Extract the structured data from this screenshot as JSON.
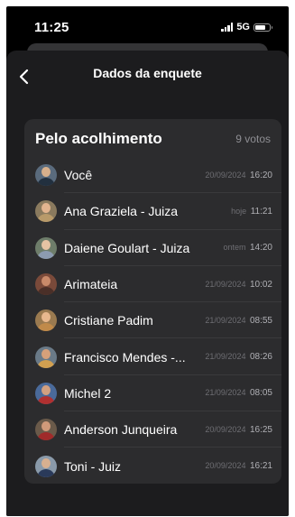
{
  "status_bar": {
    "time": "11:25",
    "network": "5G"
  },
  "header": {
    "title": "Dados da enquete",
    "back_icon": "chevron-left-icon"
  },
  "poll": {
    "option_title": "Pelo acolhimento",
    "vote_count": "9 votos",
    "votes": [
      {
        "name": "Você",
        "date": "20/09/2024",
        "time": "16:20",
        "avatar_bg": "#5a6b7d",
        "avatar_skin": "#d8b08c",
        "avatar_cloth": "#22303f"
      },
      {
        "name": "Ana Graziela - Juiza",
        "date": "hoje",
        "time": "11:21",
        "avatar_bg": "#8a7a5e",
        "avatar_skin": "#e2b48f",
        "avatar_cloth": "#b89a6a"
      },
      {
        "name": "Daiene Goulart - Juiza",
        "date": "ontem",
        "time": "14:20",
        "avatar_bg": "#6e7d6a",
        "avatar_skin": "#e5c3a3",
        "avatar_cloth": "#8c9bb0"
      },
      {
        "name": "Arimateia",
        "date": "21/09/2024",
        "time": "10:02",
        "avatar_bg": "#7a4a3a",
        "avatar_skin": "#c98a6a",
        "avatar_cloth": "#4a2f28"
      },
      {
        "name": "Cristiane Padim",
        "date": "21/09/2024",
        "time": "08:55",
        "avatar_bg": "#9a7a50",
        "avatar_skin": "#e8b88e",
        "avatar_cloth": "#c08a4a"
      },
      {
        "name": "Francisco Mendes -...",
        "date": "21/09/2024",
        "time": "08:26",
        "avatar_bg": "#6a7a88",
        "avatar_skin": "#d6a07a",
        "avatar_cloth": "#d2a050"
      },
      {
        "name": "Michel 2",
        "date": "21/09/2024",
        "time": "08:05",
        "avatar_bg": "#4a6a9a",
        "avatar_skin": "#d2a080",
        "avatar_cloth": "#b03030"
      },
      {
        "name": "Anderson Junqueira",
        "date": "20/09/2024",
        "time": "16:25",
        "avatar_bg": "#6a5a4a",
        "avatar_skin": "#d09a7a",
        "avatar_cloth": "#a02a2a"
      },
      {
        "name": "Toni - Juiz",
        "date": "20/09/2024",
        "time": "16:21",
        "avatar_bg": "#8a9aaa",
        "avatar_skin": "#d8b090",
        "avatar_cloth": "#2a3a5a"
      }
    ]
  }
}
